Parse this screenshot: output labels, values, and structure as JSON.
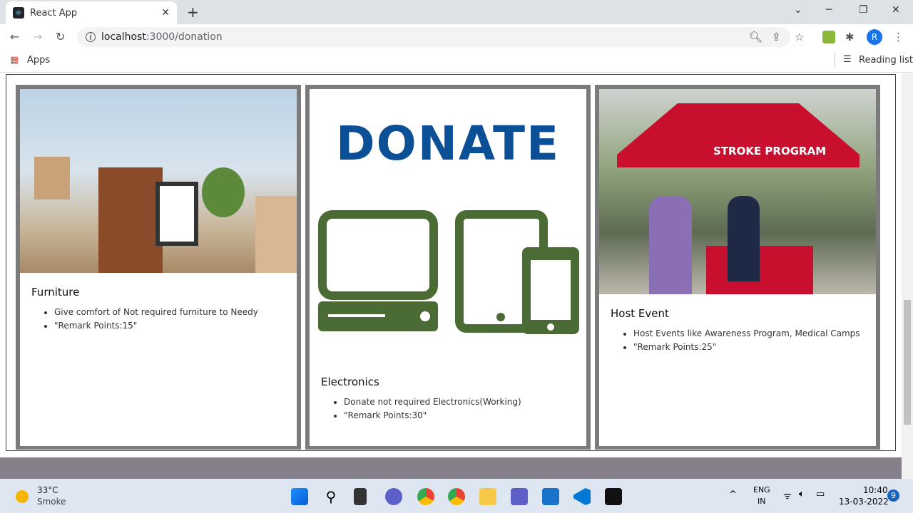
{
  "browser": {
    "tab_title": "React App",
    "url_host": "localhost",
    "url_path": ":3000/donation",
    "bookmark_apps": "Apps",
    "reading_list": "Reading list",
    "profile_initial": "R"
  },
  "cards": [
    {
      "title": "Furniture",
      "items": [
        "Give comfort of Not required furniture to Needy",
        "\"Remark Points:15\""
      ]
    },
    {
      "title": "Electronics",
      "image_text": "DONATE",
      "items": [
        "Donate not required Electronics(Working)",
        "\"Remark Points:30\""
      ]
    },
    {
      "title": "Host Event",
      "image_text": "STROKE PROGRAM",
      "items": [
        "Host Events like Awareness Program, Medical Camps",
        "\"Remark Points:25\""
      ]
    }
  ],
  "colors": {
    "donate_blue": "#0b4f97",
    "device_green": "#4a6b34",
    "card_border": "#7b7b7b"
  },
  "taskbar": {
    "temp": "33°C",
    "weather": "Smoke",
    "lang": "ENG",
    "region": "IN",
    "time": "10:40",
    "date": "13-03-2022",
    "notif_count": "9"
  }
}
